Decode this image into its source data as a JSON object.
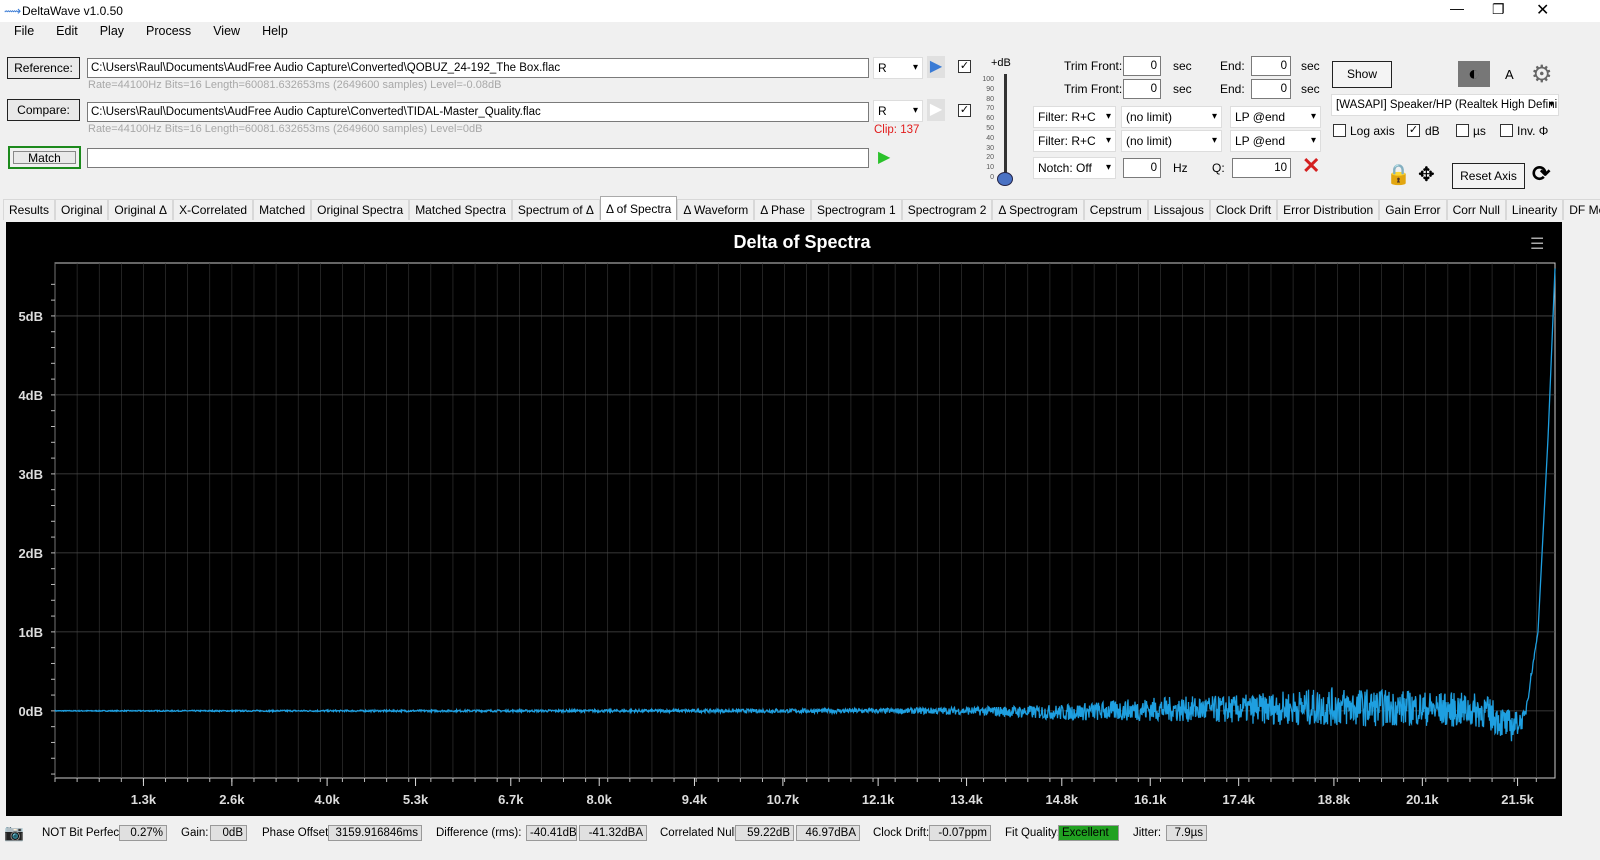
{
  "window": {
    "title": "DeltaWave v1.0.50"
  },
  "menu": [
    "File",
    "Edit",
    "Play",
    "Process",
    "View",
    "Help"
  ],
  "reference": {
    "label": "Reference:",
    "path": "C:\\Users\\Raul\\Documents\\AudFree Audio Capture\\Converted\\QOBUZ_24-192_The Box.flac",
    "channel": "R",
    "info": "Rate=44100Hz Bits=16 Length=60081.632653ms (2649600 samples) Level=-0.08dB",
    "checked": true
  },
  "compare": {
    "label": "Compare:",
    "path": "C:\\Users\\Raul\\Documents\\AudFree Audio Capture\\Converted\\TIDAL-Master_Quality.flac",
    "channel": "R",
    "info": "Rate=44100Hz Bits=16 Length=60081.632653ms (2649600 samples) Level=0dB",
    "clip": "Clip: 137",
    "checked": true
  },
  "match": {
    "label": "Match",
    "value": ""
  },
  "level": {
    "label": "+dB",
    "ticks": [
      "100",
      "90",
      "80",
      "70",
      "60",
      "50",
      "40",
      "30",
      "20",
      "10",
      "0"
    ],
    "value": 0
  },
  "trim": [
    {
      "front_label": "Trim Front:",
      "front": "0",
      "unit": "sec",
      "end_label": "End:",
      "end": "0",
      "end_unit": "sec"
    },
    {
      "front_label": "Trim Front:",
      "front": "0",
      "unit": "sec",
      "end_label": "End:",
      "end": "0",
      "end_unit": "sec"
    }
  ],
  "filters": [
    {
      "filter": "Filter: R+C",
      "limit": "(no limit)",
      "lp": "LP @end"
    },
    {
      "filter": "Filter: R+C",
      "limit": "(no limit)",
      "lp": "LP @end"
    }
  ],
  "notch": {
    "label": "Notch: Off",
    "hz": "0",
    "hz_unit": "Hz",
    "q_label": "Q:",
    "q": "10"
  },
  "right": {
    "show": "Show",
    "theme_letter": "A",
    "device": "[WASAPI] Speaker/HP (Realtek High Defini",
    "log_axis": "Log axis",
    "db": "dB",
    "us": "µs",
    "inv": "Inv. Φ",
    "reset_axis": "Reset Axis",
    "db_checked": true
  },
  "tabs": [
    "Results",
    "Original",
    "Original Δ",
    "X-Correlated",
    "Matched",
    "Original Spectra",
    "Matched Spectra",
    "Spectrum of Δ",
    "Δ of Spectra",
    "Δ Waveform",
    "Δ Phase",
    "Spectrogram 1",
    "Spectrogram 2",
    "Δ Spectrogram",
    "Cepstrum",
    "Lissajous",
    "Clock Drift",
    "Error Distribution",
    "Gain Error",
    "Corr Null",
    "Linearity",
    "DF Metric"
  ],
  "active_tab": 8,
  "chart_data": {
    "type": "line",
    "title": "Delta of Spectra",
    "xlabel": "",
    "ylabel": "",
    "xlim": [
      0,
      22050
    ],
    "ylim": [
      -0.85,
      5.67
    ],
    "x_ticks": [
      1300,
      2600,
      4000,
      5300,
      6700,
      8000,
      9400,
      10700,
      12100,
      13400,
      14800,
      16100,
      17400,
      18800,
      20100,
      21500
    ],
    "x_tick_labels": [
      "1.3k",
      "2.6k",
      "4.0k",
      "5.3k",
      "6.7k",
      "8.0k",
      "9.4k",
      "10.7k",
      "12.1k",
      "13.4k",
      "14.8k",
      "16.1k",
      "17.4k",
      "18.8k",
      "20.1k",
      "21.5k"
    ],
    "y_ticks": [
      0,
      1,
      2,
      3,
      4,
      5
    ],
    "y_tick_labels": [
      "0dB",
      "1dB",
      "2dB",
      "3dB",
      "4dB",
      "5dB"
    ],
    "grid": true,
    "line_color": "#1e9fe0",
    "series": [
      {
        "x": [
          0,
          4000,
          8000,
          12000,
          13400,
          14800,
          16100,
          17400,
          18800,
          20100,
          21000,
          21400,
          21600,
          21800,
          21950,
          22050
        ],
        "y": [
          0,
          0,
          0,
          0,
          0,
          -0.02,
          0.02,
          0.02,
          0.05,
          0.03,
          0,
          -0.2,
          -0.1,
          1.0,
          3.5,
          5.6
        ],
        "noise_amplitude_db": [
          0.005,
          0.01,
          0.015,
          0.03,
          0.05,
          0.1,
          0.15,
          0.18,
          0.25,
          0.22,
          0.22,
          0.2,
          0.1,
          0,
          0,
          0
        ]
      }
    ]
  },
  "status": {
    "bit_perfect": "NOT Bit Perfect",
    "bit_perfect_val": "0.27%",
    "gain_label": "Gain:",
    "gain": "0dB",
    "phase_label": "Phase Offset:",
    "phase": "3159.916846ms",
    "diff_label": "Difference (rms):",
    "diff_db": "-40.41dB",
    "diff_dba": "-41.32dBA",
    "null_label": "Correlated Null:",
    "null_db": "59.22dB",
    "null_dba": "46.97dBA",
    "drift_label": "Clock Drift:",
    "drift": "-0.07ppm",
    "fit_label": "Fit Quality:",
    "fit": "Excellent",
    "jitter_label": "Jitter:",
    "jitter": "7.9µs"
  }
}
